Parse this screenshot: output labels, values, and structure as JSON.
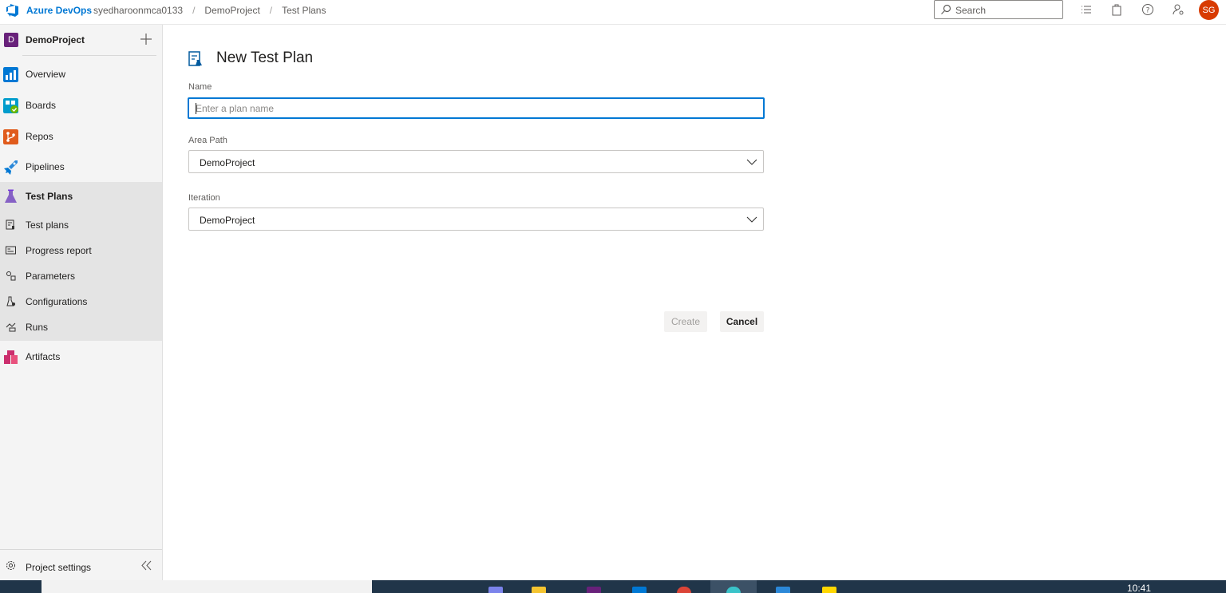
{
  "topbar": {
    "brand": "Azure DevOps",
    "breadcrumbs": [
      "syedharoonmca0133",
      "DemoProject",
      "Test Plans"
    ],
    "search_placeholder": "Search",
    "avatar_initials": "SG",
    "avatar_color": "#d83b01"
  },
  "sidebar": {
    "project_initial": "D",
    "project_name": "DemoProject",
    "items": [
      {
        "label": "Overview",
        "icon": "overview-icon"
      },
      {
        "label": "Boards",
        "icon": "boards-icon"
      },
      {
        "label": "Repos",
        "icon": "repos-icon"
      },
      {
        "label": "Pipelines",
        "icon": "pipelines-icon"
      },
      {
        "label": "Test Plans",
        "icon": "test-plans-icon"
      },
      {
        "label": "Artifacts",
        "icon": "artifacts-icon"
      }
    ],
    "subitems": [
      {
        "label": "Test plans",
        "icon": "test-plans-list-icon"
      },
      {
        "label": "Progress report",
        "icon": "progress-report-icon"
      },
      {
        "label": "Parameters",
        "icon": "parameters-icon"
      },
      {
        "label": "Configurations",
        "icon": "configurations-icon"
      },
      {
        "label": "Runs",
        "icon": "runs-icon"
      }
    ],
    "settings_label": "Project settings"
  },
  "form": {
    "title": "New Test Plan",
    "name_label": "Name",
    "name_placeholder": "Enter a plan name",
    "name_value": "",
    "area_path_label": "Area Path",
    "area_path_value": "DemoProject",
    "iteration_label": "Iteration",
    "iteration_value": "DemoProject",
    "create_label": "Create",
    "cancel_label": "Cancel"
  },
  "taskbar": {
    "clock": "10:41"
  },
  "colors": {
    "accent": "#0078d4",
    "test_plans": "#8661c5",
    "boards": "#009ccc",
    "repos": "#e05b1c",
    "artifacts": "#cb2e6d"
  }
}
